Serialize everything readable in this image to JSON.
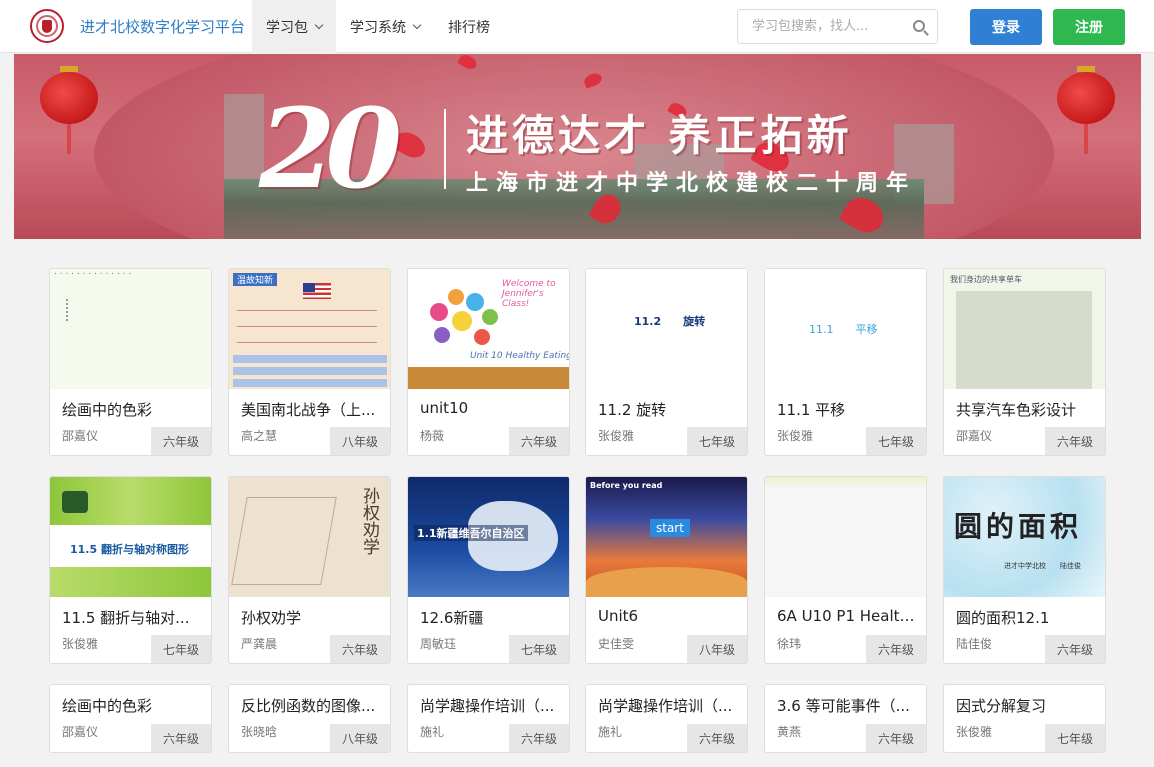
{
  "header": {
    "site_title": "进才北校数字化学习平台",
    "nav": [
      {
        "label": "学习包",
        "has_dropdown": true,
        "active": true
      },
      {
        "label": "学习系统",
        "has_dropdown": true,
        "active": false
      },
      {
        "label": "排行榜",
        "has_dropdown": false,
        "active": false
      }
    ],
    "search_placeholder": "学习包搜索，找人...",
    "login_label": "登录",
    "register_label": "注册"
  },
  "banner": {
    "number": "20",
    "slogan": "进德达才 养正拓新",
    "subtitle": "上海市进才中学北校建校二十周年"
  },
  "thumb_text": {
    "t4": "11.2　　旋转",
    "t5": "11.1　　平移",
    "t3_welcome": "Welcome to Jennifer's Class!",
    "t3_unit": "Unit 10 Healthy Eating",
    "t7": "11.5 翻折与轴对称图形",
    "t8": "孙权劝学",
    "t9": "1.1新疆维吾尔自治区",
    "t10_top": "Before you read",
    "t10_btn": "start",
    "t12_title": "圆的面积",
    "t12_sub": "进才中学北校　　陆佳俊",
    "t6_header": "我们身边的共享单车",
    "t2_header": "温故知新"
  },
  "cards": [
    {
      "title": "绘画中的色彩",
      "author": "邵嘉仪",
      "grade": "六年级"
    },
    {
      "title": "美国南北战争（上...",
      "author": "高之慧",
      "grade": "八年级"
    },
    {
      "title": "unit10",
      "author": "杨薇",
      "grade": "六年级"
    },
    {
      "title": "11.2 旋转",
      "author": "张俊雅",
      "grade": "七年级"
    },
    {
      "title": "11.1 平移",
      "author": "张俊雅",
      "grade": "七年级"
    },
    {
      "title": "共享汽车色彩设计",
      "author": "邵嘉仪",
      "grade": "六年级"
    },
    {
      "title": "11.5 翻折与轴对...",
      "author": "张俊雅",
      "grade": "七年级"
    },
    {
      "title": "孙权劝学",
      "author": "严龚晨",
      "grade": "六年级"
    },
    {
      "title": "12.6新疆",
      "author": "周敏珏",
      "grade": "七年级"
    },
    {
      "title": "Unit6",
      "author": "史佳雯",
      "grade": "八年级"
    },
    {
      "title": "6A U10 P1 Health...",
      "author": "徐玮",
      "grade": "六年级"
    },
    {
      "title": "圆的面积12.1",
      "author": "陆佳俊",
      "grade": "六年级"
    },
    {
      "title": "绘画中的色彩",
      "author": "邵嘉仪",
      "grade": "六年级"
    },
    {
      "title": "反比例函数的图像...",
      "author": "张晓晗",
      "grade": "八年级"
    },
    {
      "title": "尚学趣操作培训（...",
      "author": "施礼",
      "grade": "六年级"
    },
    {
      "title": "尚学趣操作培训（...",
      "author": "施礼",
      "grade": "六年级"
    },
    {
      "title": "3.6 等可能事件（...",
      "author": "黄燕",
      "grade": "六年级"
    },
    {
      "title": "因式分解复习",
      "author": "张俊雅",
      "grade": "七年级"
    }
  ]
}
